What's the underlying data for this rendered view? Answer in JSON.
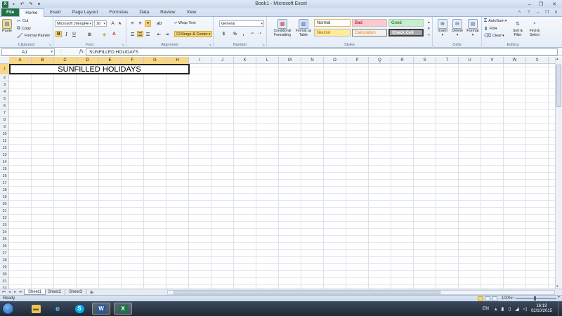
{
  "window": {
    "title": "Book1 - Microsoft Excel",
    "minimize": "–",
    "restore": "❐",
    "close": "✕"
  },
  "tabs": [
    "File",
    "Home",
    "Insert",
    "Page Layout",
    "Formulas",
    "Data",
    "Review",
    "View"
  ],
  "ribbon": {
    "clipboard": {
      "label": "Clipboard",
      "paste": "Paste",
      "cut": "Cut",
      "copy": "Copy",
      "format_painter": "Format Painter"
    },
    "font": {
      "label": "Font",
      "name": "Microsoft JhengHe",
      "size": "16",
      "bold": "B",
      "italic": "I",
      "underline": "U"
    },
    "alignment": {
      "label": "Alignment",
      "wrap_text": "Wrap Text",
      "merge_center": "Merge & Center"
    },
    "number": {
      "label": "Number",
      "format": "General",
      "currency": "$",
      "percent": "%",
      "comma": ","
    },
    "styles": {
      "label": "Styles",
      "conditional": "Conditional Formatting",
      "format_table": "Format as Table",
      "normal": "Normal",
      "bad": "Bad",
      "good": "Good",
      "neutral": "Neutral",
      "calculation": "Calculation",
      "check_cell": "Check Cell"
    },
    "cells": {
      "label": "Cells",
      "insert": "Insert",
      "delete": "Delete",
      "format": "Format"
    },
    "editing": {
      "label": "Editing",
      "autosum": "AutoSum",
      "fill": "Fill",
      "clear": "Clear",
      "sort_filter": "Sort & Filter",
      "find_select": "Find & Select"
    }
  },
  "formula_bar": {
    "name_box": "A1",
    "fx": "fx",
    "content": "SUNFILLED HOLIDAYS"
  },
  "columns": [
    "A",
    "B",
    "C",
    "D",
    "E",
    "F",
    "G",
    "H",
    "I",
    "J",
    "K",
    "L",
    "M",
    "N",
    "O",
    "P",
    "Q",
    "R",
    "S",
    "T",
    "U",
    "V",
    "W",
    "X"
  ],
  "rows": [
    "1",
    "2",
    "3",
    "4",
    "5",
    "6",
    "7",
    "8",
    "9",
    "10",
    "11",
    "12",
    "13",
    "14",
    "15",
    "16",
    "17",
    "18",
    "19",
    "20",
    "21",
    "22",
    "23",
    "24",
    "25",
    "26",
    "27",
    "28",
    "29",
    "30",
    "31",
    "32"
  ],
  "cells": {
    "A1": "SUNFILLED HOLIDAYS"
  },
  "sheets": [
    "Sheet1",
    "Sheet2",
    "Sheet3"
  ],
  "status": {
    "text": "Ready",
    "zoom": "100%",
    "zoom_minus": "−",
    "zoom_plus": "+"
  },
  "taskbar": {
    "apps": [
      {
        "name": "explorer",
        "glyph": "▬"
      },
      {
        "name": "internet-explorer",
        "glyph": "e"
      },
      {
        "name": "skype",
        "glyph": "S"
      },
      {
        "name": "word",
        "glyph": "W"
      },
      {
        "name": "excel",
        "glyph": "X"
      }
    ],
    "language": "EN",
    "time": "16:19",
    "date": "02/10/2015"
  },
  "colors": {
    "accent": "#217346",
    "selection": "#f7d888"
  }
}
